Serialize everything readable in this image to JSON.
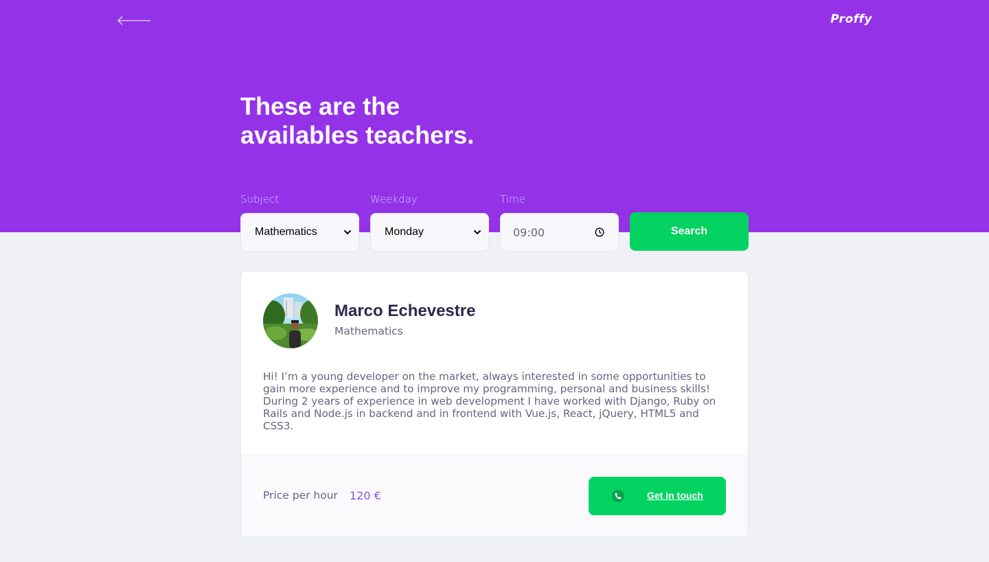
{
  "app": {
    "logo": "Proffy",
    "back_icon": "arrow-left-icon"
  },
  "page": {
    "title_line1": "These are the",
    "title_line2": "availables teachers."
  },
  "filters": {
    "subject": {
      "label": "Subject",
      "value": "Mathematics"
    },
    "weekday": {
      "label": "Weekday",
      "value": "Monday"
    },
    "time": {
      "label": "Time",
      "value": "09:00"
    },
    "search_label": "Search"
  },
  "teacher": {
    "name": "Marco Echevestre",
    "subject": "Mathematics",
    "bio": "Hi! I’m a young developer on the market, always interested in some opportunities to gain more experience and to improve my programming, personal and business skills! During 2 years of experience in web development I have worked with Django, Ruby on Rails and Node.js in backend and in frontend with Vue.js, React, jQuery, HTML5 and CSS3.",
    "price_label": "Price per hour",
    "price": "120 €",
    "contact_label": "Get in touch",
    "contact_icon": "whatsapp-icon"
  },
  "colors": {
    "primary": "#9432E8",
    "accent_green": "#04D361",
    "background": "#F0F0F7",
    "price_purple": "#8257E5"
  }
}
